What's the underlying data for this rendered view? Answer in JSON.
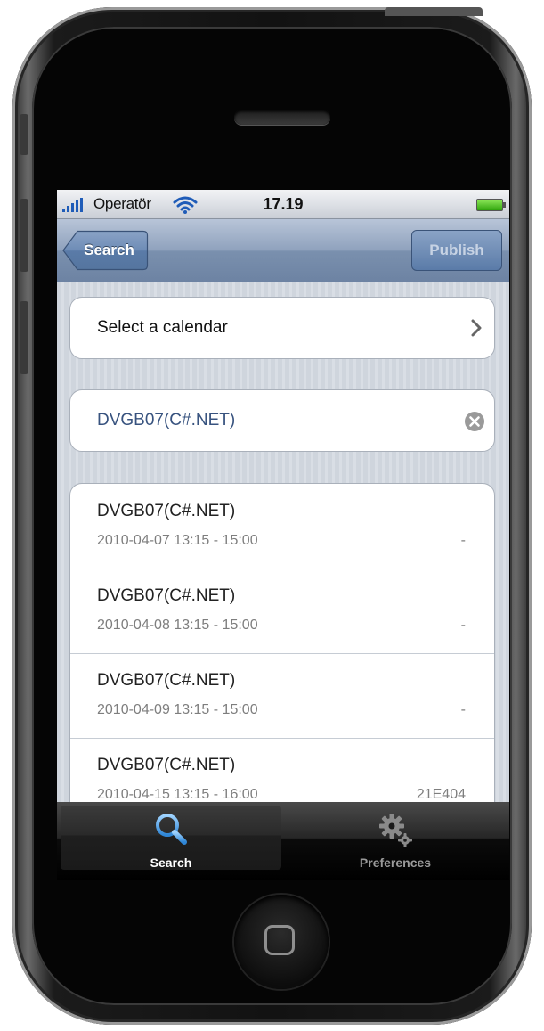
{
  "status_bar": {
    "carrier": "Operatör",
    "time": "17.19"
  },
  "nav_bar": {
    "back_label": "Search",
    "publish_label": "Publish"
  },
  "calendar_selector": {
    "label": "Select a calendar"
  },
  "search_field": {
    "value": "DVGB07(C#.NET)"
  },
  "results": [
    {
      "title": "DVGB07(C#.NET)",
      "when": "2010-04-07 13:15 - 15:00",
      "room": "-"
    },
    {
      "title": "DVGB07(C#.NET)",
      "when": "2010-04-08 13:15 - 15:00",
      "room": "-"
    },
    {
      "title": "DVGB07(C#.NET)",
      "when": "2010-04-09 13:15 - 15:00",
      "room": "-"
    },
    {
      "title": "DVGB07(C#.NET)",
      "when": "2010-04-15 13:15 - 16:00",
      "room": "21E404"
    }
  ],
  "tab_bar": {
    "tabs": [
      {
        "label": "Search",
        "icon": "magnifier-icon",
        "selected": true
      },
      {
        "label": "Preferences",
        "icon": "gears-icon",
        "selected": false
      }
    ]
  },
  "colors": {
    "nav_bar": "#7a90ae",
    "search_text": "#38537f",
    "selected_tab_icon": "#4fa3e6",
    "battery": "#2fa40c",
    "signal": "#1f5cb8"
  }
}
